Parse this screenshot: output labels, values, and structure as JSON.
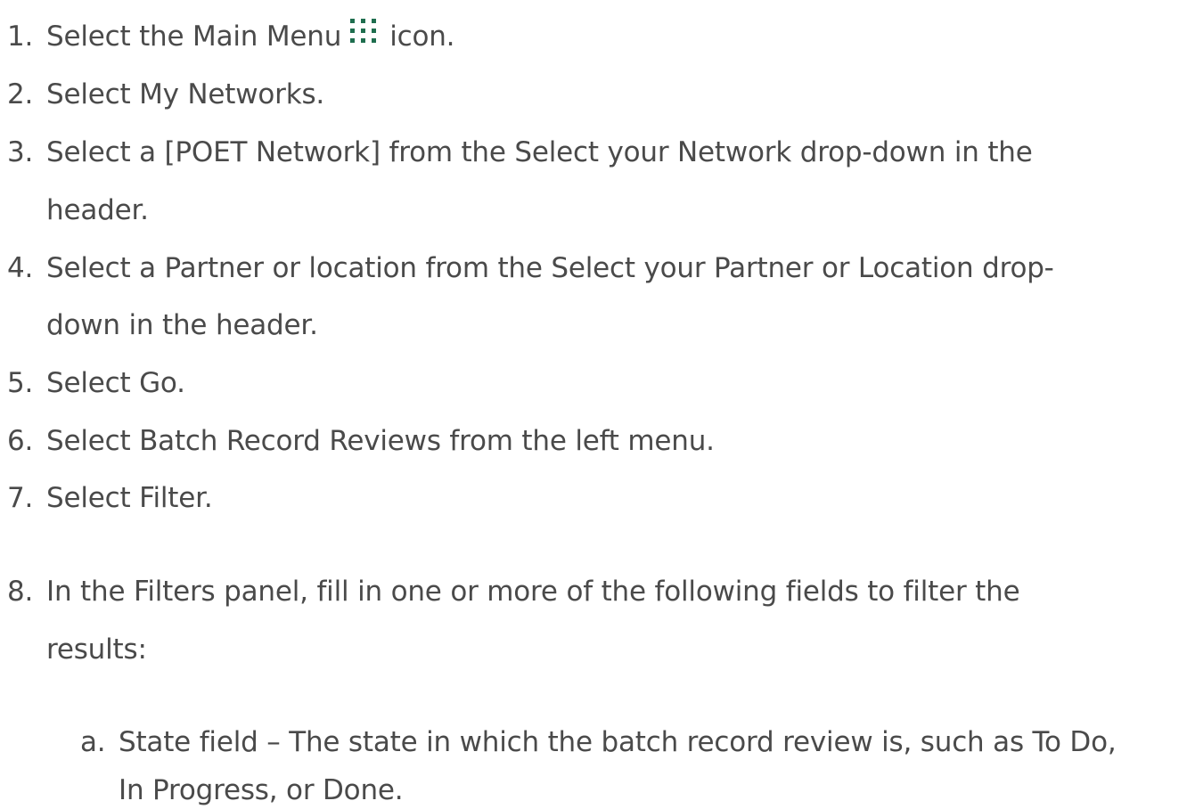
{
  "steps": [
    {
      "num": "1.",
      "pre": "Select the Main Menu",
      "icon": "grid-dots-icon",
      "post": "icon."
    },
    {
      "num": "2.",
      "text": "Select My Networks."
    },
    {
      "num": "3.",
      "line1": "Select a [POET Network] from the Select your Network drop-down in the",
      "line2": "header."
    },
    {
      "num": "4.",
      "line1": "Select a Partner or location from the Select your Partner or Location drop-",
      "line2": "down in the header."
    },
    {
      "num": "5.",
      "text": "Select Go."
    },
    {
      "num": "6.",
      "text": "Select Batch Record Reviews from the left menu."
    },
    {
      "num": "7.",
      "text": "Select Filter."
    },
    {
      "num": "8.",
      "line1": "In the Filters panel, fill in one or more of the following fields to filter the",
      "line2": "results:"
    }
  ],
  "substeps": [
    {
      "num": "a.",
      "line1": "State field – The state in which the batch record review is, such as To Do,",
      "line2": "In Progress, or Done."
    }
  ],
  "colors": {
    "text": "#4a4a4a",
    "icon": "#1f6e4f"
  }
}
